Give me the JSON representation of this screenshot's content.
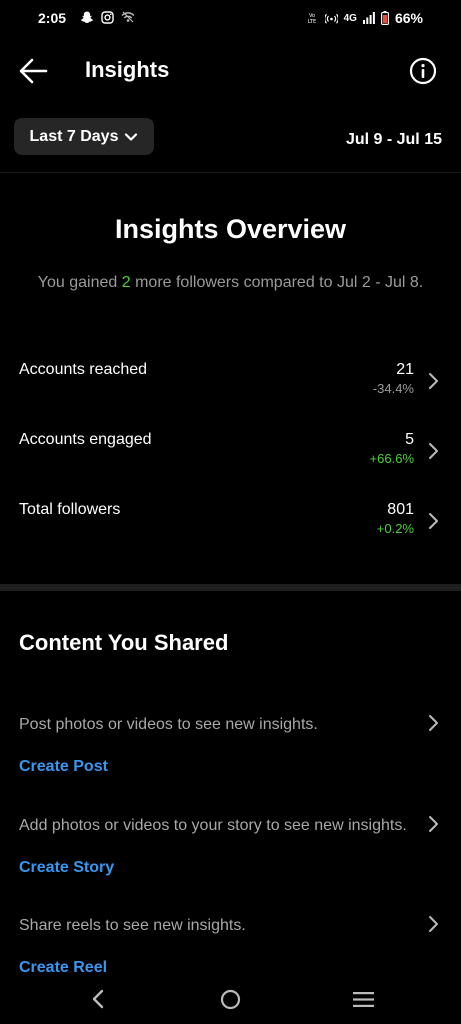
{
  "status_bar": {
    "time": "2:05",
    "network_label": "4G",
    "battery": "66%",
    "icons_left": [
      "snapchat-icon",
      "instagram-icon",
      "wifi-off-icon"
    ],
    "icons_right": [
      "volte-icon",
      "hotspot-icon",
      "signal-icon",
      "battery-icon"
    ]
  },
  "header": {
    "title": "Insights",
    "back_icon": "arrow-left-icon",
    "info_icon": "info-icon"
  },
  "range": {
    "selector_label": "Last 7 Days",
    "date_range": "Jul 9 - Jul 15"
  },
  "overview": {
    "title": "Insights Overview",
    "subtitle_prefix": "You gained ",
    "subtitle_number": "2",
    "subtitle_suffix": " more followers compared to Jul 2 - Jul 8."
  },
  "metrics": [
    {
      "label": "Accounts reached",
      "value": "21",
      "change": "-34.4%"
    },
    {
      "label": "Accounts engaged",
      "value": "5",
      "change": "+66.6%"
    },
    {
      "label": "Total followers",
      "value": "801",
      "change": "+0.2%"
    }
  ],
  "content": {
    "title": "Content You Shared",
    "items": [
      {
        "text": "Post photos or videos to see new insights.",
        "link": "Create Post"
      },
      {
        "text": "Add photos or videos to your story to see new insights.",
        "link": "Create Story"
      },
      {
        "text": "Share reels to see new insights.",
        "link": "Create Reel"
      }
    ]
  },
  "colors": {
    "background": "#000000",
    "positive": "#4cd137",
    "link": "#3897f0",
    "muted": "#9a9a9a"
  }
}
